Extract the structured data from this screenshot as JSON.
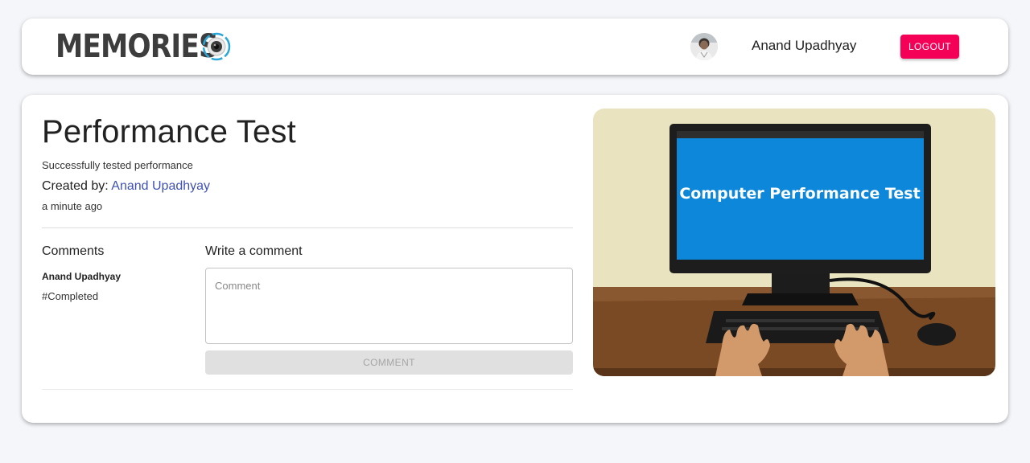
{
  "header": {
    "brand": "MEMORIES",
    "user_name": "Anand Upadhyay",
    "logout_label": "LOGOUT",
    "logout_color": "#f50057"
  },
  "post": {
    "title": "Performance Test",
    "message": "Successfully tested performance",
    "created_by_prefix": "Created by: ",
    "creator": "Anand Upadhyay",
    "time_ago": "a minute ago",
    "image_caption": "Computer Performance Test"
  },
  "comments": {
    "heading": "Comments",
    "items": [
      {
        "author": "Anand Upadhyay",
        "text": "#Completed"
      }
    ]
  },
  "comment_form": {
    "heading": "Write a comment",
    "placeholder": "Comment",
    "value": "",
    "submit_label": "COMMENT"
  }
}
